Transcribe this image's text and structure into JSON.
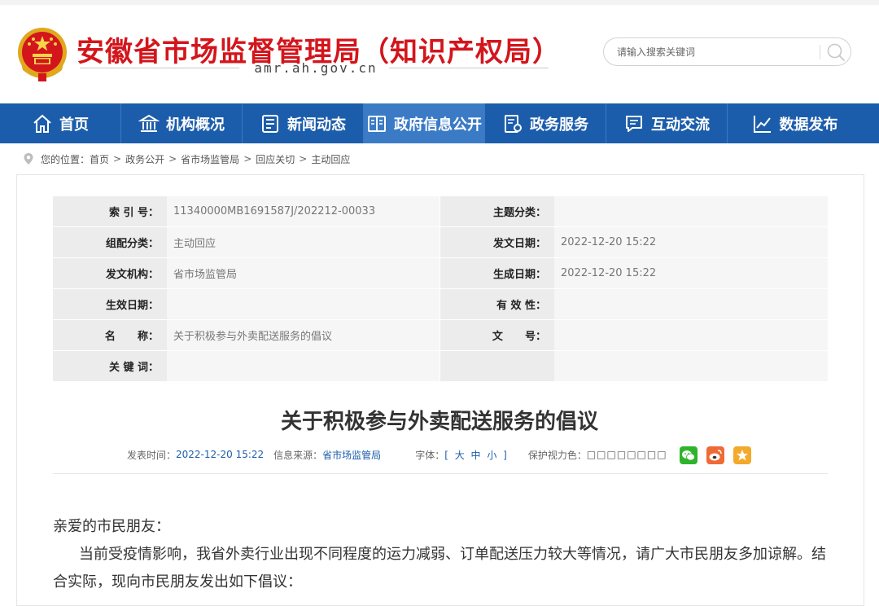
{
  "header": {
    "site_title": "安徽省市场监督管理局（知识产权局）",
    "site_domain": "amr.ah.gov.cn",
    "emblem_icon": "national-emblem-icon",
    "search": {
      "placeholder": "请输入搜索关键词",
      "icon": "search-icon"
    }
  },
  "colors": {
    "brand_red": "#d3151c",
    "nav_blue": "#1c5dab",
    "nav_active": "#3b7bc6"
  },
  "nav": {
    "items": [
      {
        "label": "首页",
        "icon": "home-icon"
      },
      {
        "label": "机构概况",
        "icon": "building-icon"
      },
      {
        "label": "新闻动态",
        "icon": "news-icon"
      },
      {
        "label": "政府信息公开",
        "icon": "open-book-icon",
        "active": true
      },
      {
        "label": "政务服务",
        "icon": "service-icon"
      },
      {
        "label": "互动交流",
        "icon": "chat-icon"
      },
      {
        "label": "数据发布",
        "icon": "chart-icon"
      }
    ]
  },
  "breadcrumb": {
    "prefix": "您的位置：",
    "items": [
      "首页",
      "政务公开",
      "省市场监管局",
      "回应关切",
      "主动回应"
    ],
    "separator": ">"
  },
  "meta": {
    "rows": [
      {
        "l_label": "索 引 号：",
        "l_value": "11340000MB1691587J/202212-00033",
        "r_label": "主题分类：",
        "r_value": ""
      },
      {
        "l_label": "组配分类：",
        "l_value": "主动回应",
        "r_label": "发文日期：",
        "r_value": "2022-12-20 15:22"
      },
      {
        "l_label": "发文机构：",
        "l_value": "省市场监管局",
        "r_label": "生成日期：",
        "r_value": "2022-12-20 15:22"
      },
      {
        "l_label": "生效日期：",
        "l_value": "",
        "r_label": "有 效 性：",
        "r_value": ""
      },
      {
        "l_label": "名      称：",
        "l_value": "关于积极参与外卖配送服务的倡议",
        "r_label": "文      号：",
        "r_value": ""
      },
      {
        "l_label": "关 键 词：",
        "l_value": "",
        "r_label": "",
        "r_value": ""
      }
    ]
  },
  "article": {
    "title": "关于积极参与外卖配送服务的倡议",
    "info": {
      "date_label": "发表时间：",
      "date_value": "2022-12-20 15:22",
      "source_label": "信息来源：",
      "source_value": "省市场监管局",
      "font_label": "字体：",
      "font_sizes": "[ 大 中 小 ]",
      "eye_label": "保护视力色：",
      "eye_boxes": "□□□□□□□□"
    },
    "share": [
      "wechat-icon",
      "weibo-icon",
      "favorite-icon"
    ],
    "greeting": "亲爱的市民朋友：",
    "paragraph": "当前受疫情影响，我省外卖行业出现不同程度的运力减弱、订单配送压力较大等情况，请广大市民朋友多加谅解。结合实际，现向市民朋友发出如下倡议："
  }
}
